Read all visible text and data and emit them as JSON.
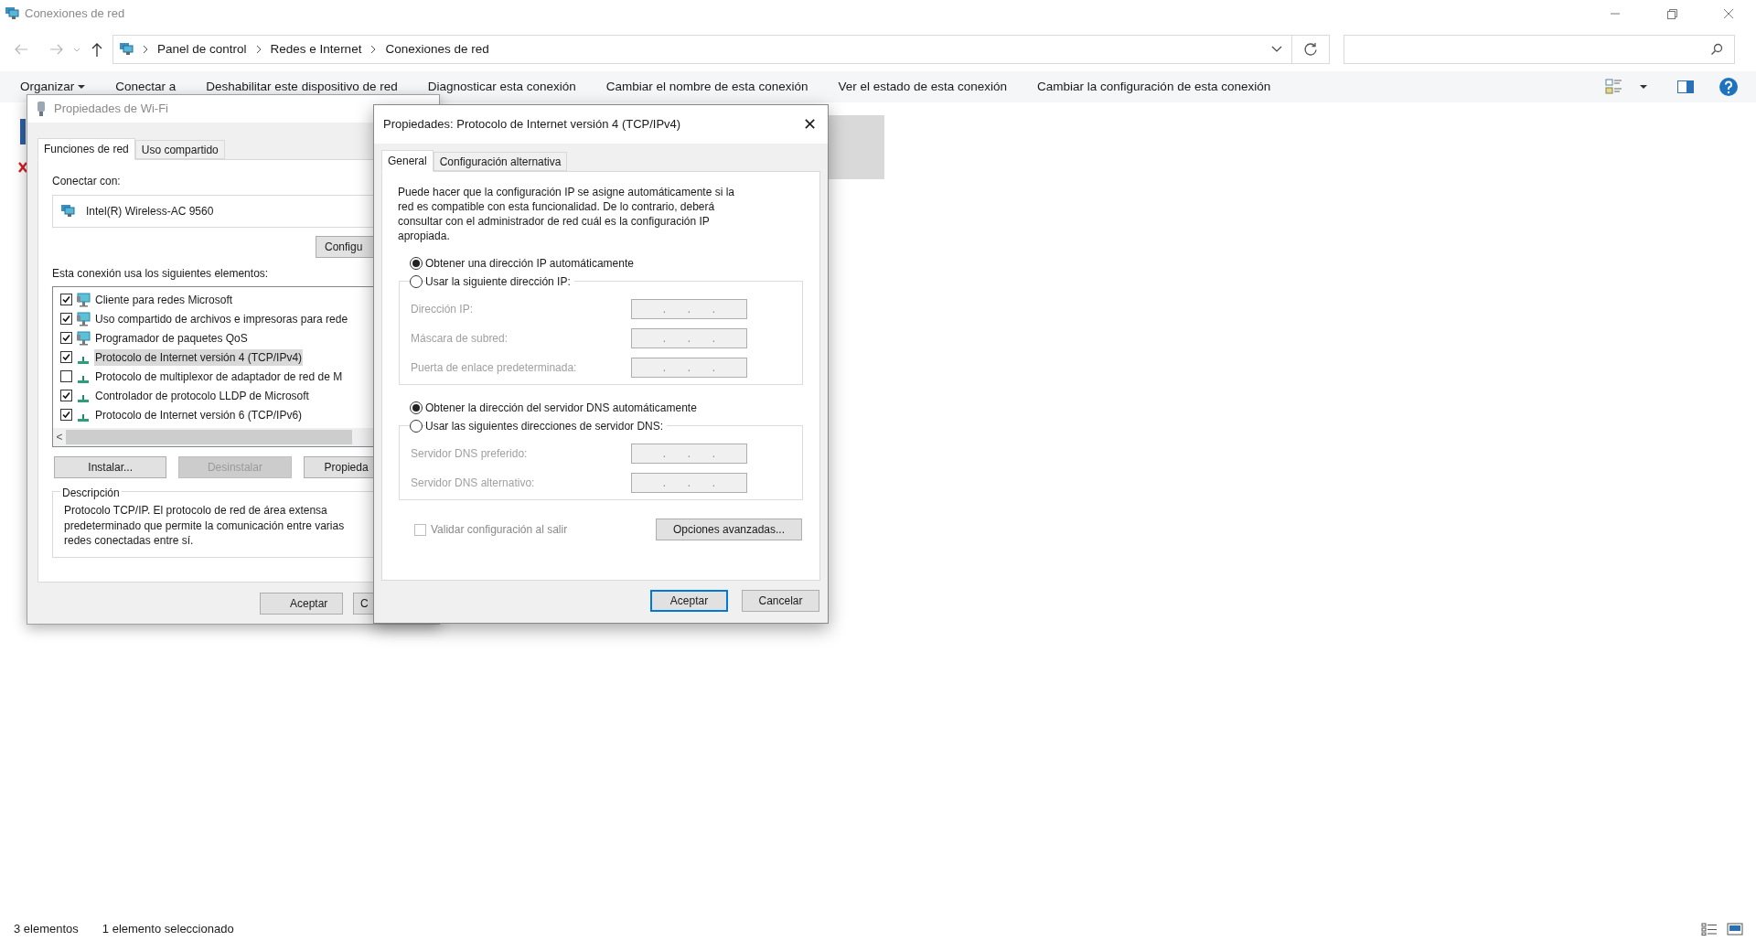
{
  "window": {
    "title": "Conexiones de red"
  },
  "address_bar": {
    "breadcrumbs": [
      "Panel de control",
      "Redes e Internet",
      "Conexiones de red"
    ]
  },
  "command_bar": [
    {
      "label": "Organizar",
      "dropdown": true
    },
    {
      "label": "Conectar a",
      "dropdown": false
    },
    {
      "label": "Deshabilitar este dispositivo de red",
      "dropdown": false
    },
    {
      "label": "Diagnosticar esta conexión",
      "dropdown": false
    },
    {
      "label": "Cambiar el nombre de esta conexión",
      "dropdown": false
    },
    {
      "label": "Ver el estado de esta conexión",
      "dropdown": false
    },
    {
      "label": "Cambiar la configuración de esta conexión",
      "dropdown": false
    }
  ],
  "wifi_dialog": {
    "title": "Propiedades de Wi-Fi",
    "tabs": [
      {
        "label": "Funciones de red",
        "selected": true
      },
      {
        "label": "Uso compartido",
        "selected": false
      }
    ],
    "connect_label": "Conectar con:",
    "adapter": "Intel(R) Wireless-AC 9560",
    "configure_button": "Configu",
    "components_label": "Esta conexión usa los siguientes elementos:",
    "components": [
      {
        "label": "Cliente para redes Microsoft",
        "checked": true,
        "selected": false,
        "kind": "service"
      },
      {
        "label": "Uso compartido de archivos e impresoras para rede",
        "checked": true,
        "selected": false,
        "kind": "service"
      },
      {
        "label": "Programador de paquetes QoS",
        "checked": true,
        "selected": false,
        "kind": "service"
      },
      {
        "label": "Protocolo de Internet versión 4 (TCP/IPv4)",
        "checked": true,
        "selected": true,
        "kind": "protocol"
      },
      {
        "label": "Protocolo de multiplexor de adaptador de red de M",
        "checked": false,
        "selected": false,
        "kind": "protocol"
      },
      {
        "label": "Controlador de protocolo LLDP de Microsoft",
        "checked": true,
        "selected": false,
        "kind": "protocol"
      },
      {
        "label": "Protocolo de Internet versión 6 (TCP/IPv6)",
        "checked": true,
        "selected": false,
        "kind": "protocol"
      }
    ],
    "scroll_left": "<",
    "buttons": [
      {
        "label": "Instalar...",
        "disabled": false
      },
      {
        "label": "Desinstalar",
        "disabled": true
      },
      {
        "label": "Propieda",
        "disabled": false
      }
    ],
    "description_title": "Descripción",
    "description_lines": [
      "Protocolo TCP/IP. El protocolo de red de área extensa",
      "predeterminado que permite la comunicación entre varias",
      "redes conectadas entre sí."
    ],
    "footer_buttons": [
      "Aceptar",
      "C"
    ]
  },
  "ipv4_dialog": {
    "title": "Propiedades: Protocolo de Internet versión 4 (TCP/IPv4)",
    "close": "✕",
    "tabs": [
      {
        "label": "General",
        "selected": true
      },
      {
        "label": "Configuración alternativa",
        "selected": false
      }
    ],
    "intro": "Puede hacer que la configuración IP se asigne automáticamente si la red es compatible con esta funcionalidad. De lo contrario, deberá consultar con el administrador de red cuál es la configuración IP apropiada.",
    "ip_options": [
      {
        "label": "Obtener una dirección IP automáticamente",
        "selected": true
      },
      {
        "label": "Usar la siguiente dirección IP:",
        "selected": false
      }
    ],
    "ip_fields": [
      {
        "label": "Dirección IP:",
        "separator": ".",
        "disabled": true
      },
      {
        "label": "Máscara de subred:",
        "separator": ".",
        "disabled": true
      },
      {
        "label": "Puerta de enlace predeterminada:",
        "separator": ".",
        "disabled": true
      }
    ],
    "dns_options": [
      {
        "label": "Obtener la dirección del servidor DNS automáticamente",
        "selected": true
      },
      {
        "label": "Usar las siguientes direcciones de servidor DNS:",
        "selected": false
      }
    ],
    "dns_fields": [
      {
        "label": "Servidor DNS preferido:",
        "separator": ".",
        "disabled": true
      },
      {
        "label": "Servidor DNS alternativo:",
        "separator": ".",
        "disabled": true
      }
    ],
    "validate": {
      "label": "Validar configuración al salir",
      "checked": false,
      "disabled": true
    },
    "advanced_button": "Opciones avanzadas...",
    "buttons": [
      {
        "label": "Aceptar",
        "default": true
      },
      {
        "label": "Cancelar",
        "default": false
      }
    ]
  },
  "status_bar": [
    "3 elementos",
    "1 elemento seleccionado"
  ]
}
